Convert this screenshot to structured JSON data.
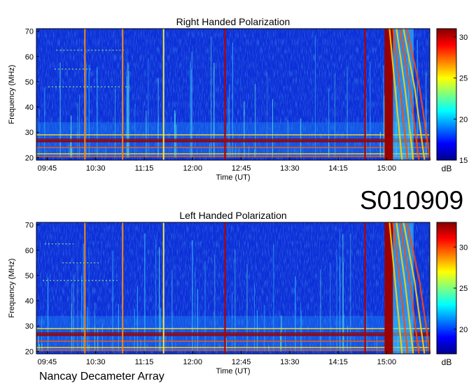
{
  "station_id": "S010909",
  "instrument": "Nancay Decameter Array",
  "chart_data": [
    {
      "type": "heatmap",
      "title": "Right Handed Polarization",
      "xlabel": "Time (UT)",
      "ylabel": "Frequency (MHz)",
      "x_ticks": [
        "09:45",
        "10:30",
        "11:15",
        "12:00",
        "12:45",
        "13:30",
        "14:15",
        "15:00"
      ],
      "y_ticks": [
        20,
        30,
        40,
        50,
        60,
        70
      ],
      "ylim": [
        19,
        71
      ],
      "colorbar": {
        "label": "dB",
        "ticks": [
          15,
          20,
          25,
          30
        ],
        "range": [
          15,
          31
        ]
      },
      "features": {
        "persistent_bands_mhz": [
          20.5,
          21.5,
          24,
          26.5,
          27.3,
          29
        ],
        "time_markers_red": [
          "12:30",
          "14:40"
        ],
        "time_markers_orange": [
          "10:20",
          "10:55"
        ],
        "time_markers_yellow": [
          "11:33"
        ],
        "strong_burst_window": [
          "15:00",
          "15:25"
        ],
        "scattered_spikes_mhz": [
          48,
          55,
          62.5
        ]
      }
    },
    {
      "type": "heatmap",
      "title": "Left Handed Polarization",
      "xlabel": "Time (UT)",
      "ylabel": "Frequency (MHz)",
      "x_ticks": [
        "09:45",
        "10:30",
        "11:15",
        "12:00",
        "12:45",
        "13:30",
        "14:15",
        "15:00"
      ],
      "y_ticks": [
        20,
        30,
        40,
        50,
        60,
        70
      ],
      "ylim": [
        19,
        71
      ],
      "colorbar": {
        "label": "dB",
        "ticks": [
          20,
          25,
          30
        ],
        "range": [
          17,
          33
        ]
      },
      "features": {
        "persistent_bands_mhz": [
          20.5,
          21.5,
          24,
          26.5,
          27.3,
          29
        ],
        "time_markers_red": [
          "12:30",
          "14:40"
        ],
        "time_markers_orange": [
          "10:20",
          "10:55"
        ],
        "time_markers_yellow": [
          "11:33"
        ],
        "strong_burst_window": [
          "15:00",
          "15:25"
        ],
        "scattered_spikes_mhz": [
          48,
          55,
          62.5
        ]
      }
    }
  ]
}
